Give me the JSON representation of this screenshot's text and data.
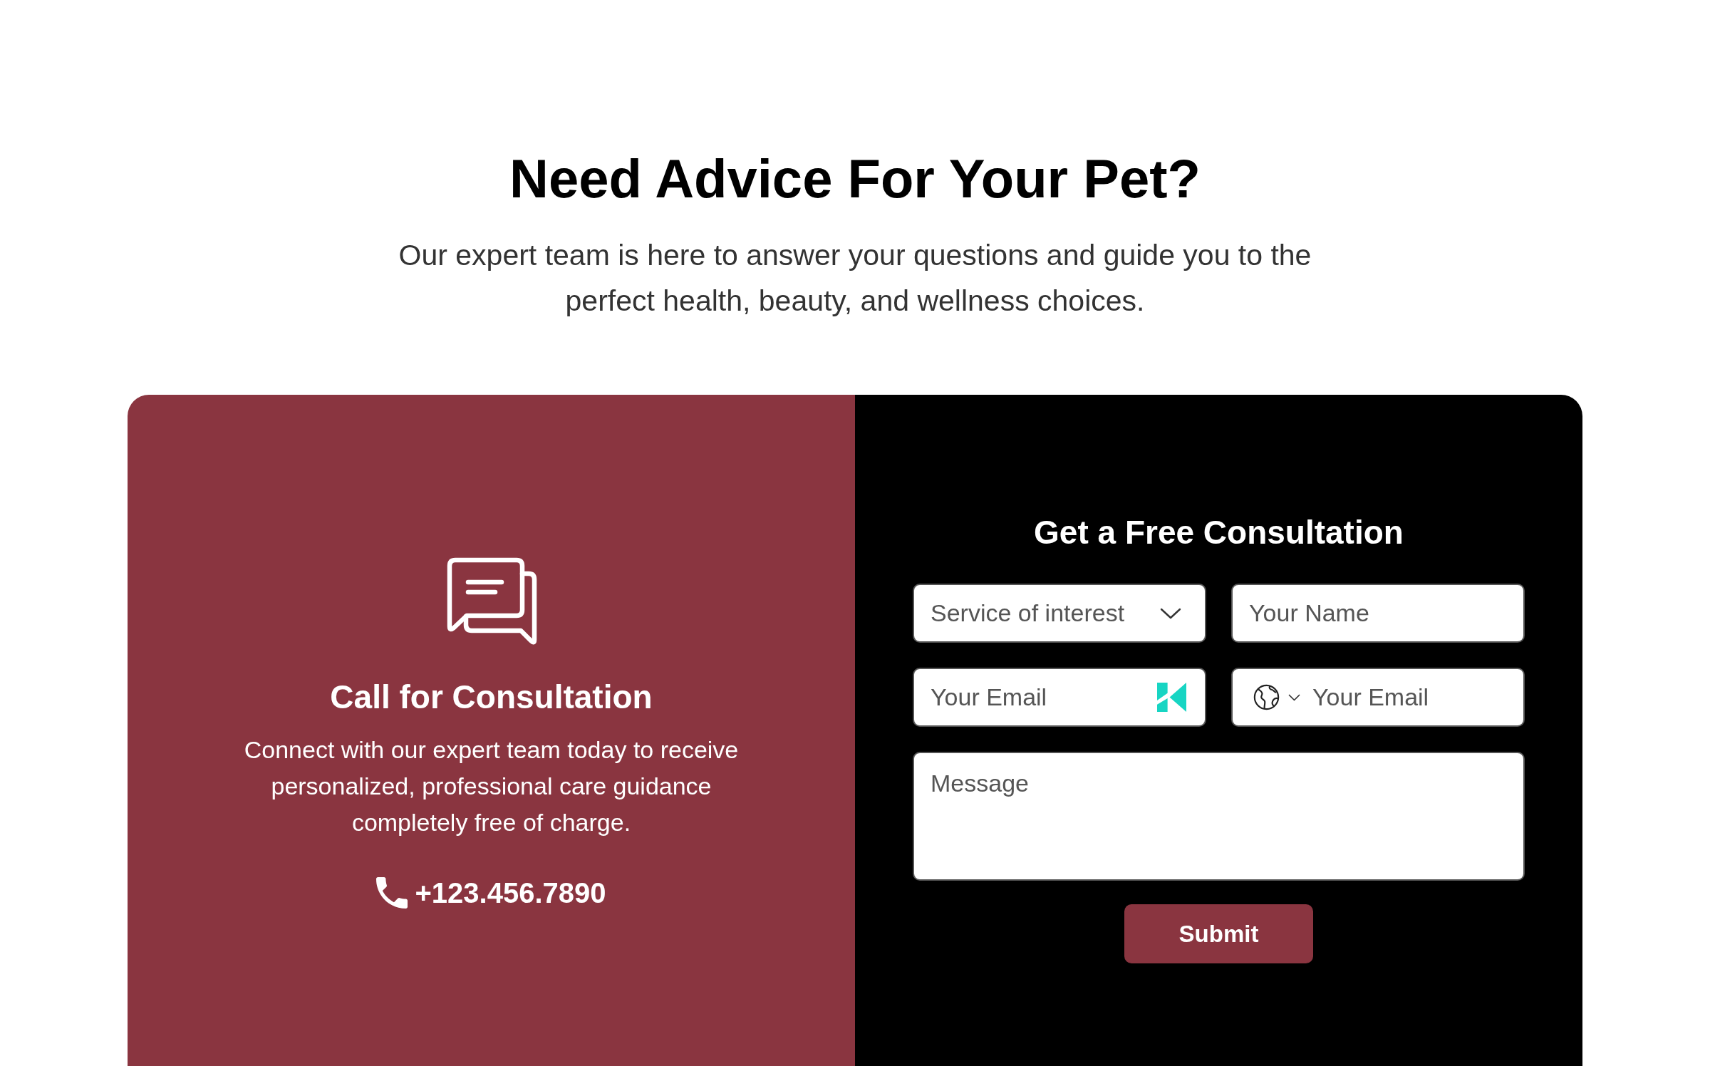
{
  "heading": "Need Advice For Your Pet?",
  "subtitle": "Our expert team is here to answer your questions and guide you to the perfect health, beauty, and wellness choices.",
  "contact_card": {
    "title": "Call for Consultation",
    "description": "Connect with our expert team today to receive personalized, professional care guidance completely free of charge.",
    "phone": "+123.456.7890"
  },
  "form": {
    "title": "Get a Free Consultation",
    "fields": [
      {
        "kind": "select",
        "placeholder": "Service of interest"
      },
      {
        "kind": "text",
        "placeholder": "Your Name"
      },
      {
        "kind": "email",
        "placeholder": "Your Email"
      },
      {
        "kind": "phone",
        "placeholder": "Your Email"
      },
      {
        "kind": "textarea",
        "placeholder": "Message"
      }
    ],
    "submit": "Submit"
  }
}
